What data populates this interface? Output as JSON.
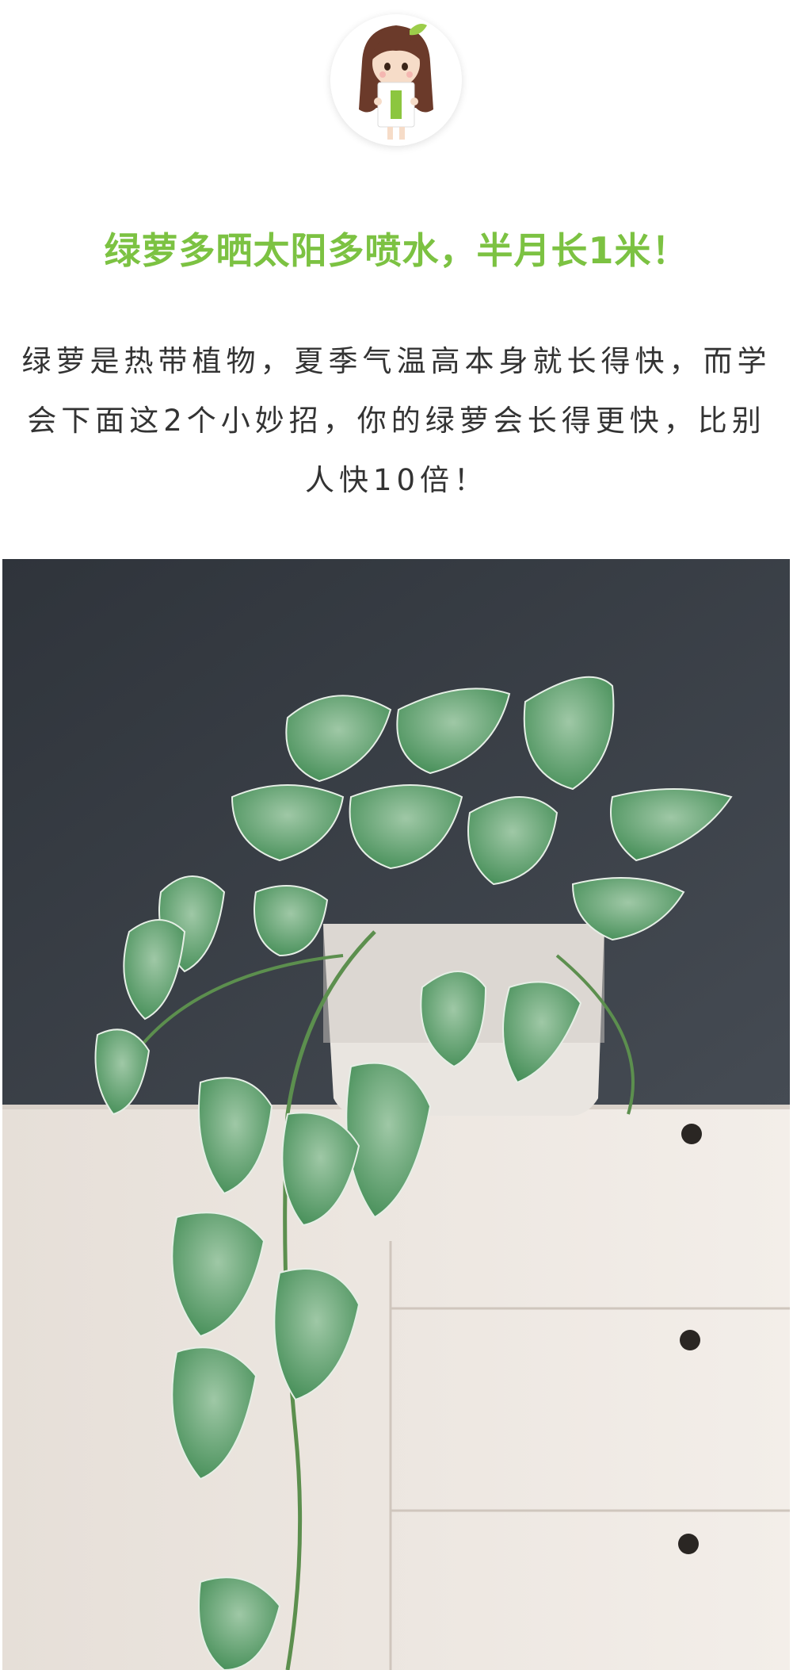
{
  "badge": {
    "number": "1",
    "icon": "girl-holding-number-card-icon",
    "accent_color": "#8cc63f"
  },
  "heading": "绿萝多晒太阳多喷水，半月长1米！",
  "paragraph": {
    "lines": [
      "绿萝是热带植物，夏季气温高本身就长得快，而学",
      "会下面这2个小妙招，你的绿萝会长得更快，比别",
      "人快10倍！"
    ]
  },
  "photo": {
    "icon": "pothos-plant-on-dresser-photo",
    "wall_color": "#3c4148",
    "cabinet_color": "#efe9e3",
    "leaf_color": "#4f9a5e"
  }
}
